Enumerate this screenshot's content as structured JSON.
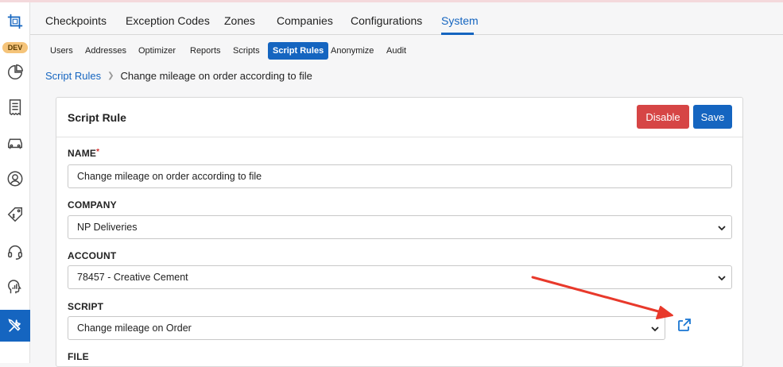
{
  "sidebar": {
    "badge": "DEV",
    "icons": [
      "crop-logo-icon",
      "pie-chart-icon",
      "receipt-icon",
      "car-icon",
      "user-circle-icon",
      "price-tag-icon",
      "headset-icon",
      "analytics-head-icon",
      "tools-icon"
    ],
    "active_item": "tools-icon"
  },
  "nav": {
    "tabs": [
      "Checkpoints",
      "Exception Codes",
      "Zones",
      "Companies",
      "Configurations",
      "System"
    ],
    "active_tab": "System"
  },
  "subnav": {
    "tabs": [
      "Users",
      "Addresses",
      "Optimizer",
      "Reports",
      "Scripts",
      "Script Rules",
      "Anonymize",
      "Audit"
    ],
    "active_tab": "Script Rules"
  },
  "breadcrumb": {
    "parent": "Script Rules",
    "current": "Change mileage on order according to file"
  },
  "card": {
    "title": "Script Rule",
    "disable_label": "Disable",
    "save_label": "Save"
  },
  "form": {
    "name_label": "NAME",
    "required_mark": "*",
    "name_value": "Change mileage on order according to file",
    "company_label": "COMPANY",
    "company_value": "NP Deliveries",
    "account_label": "ACCOUNT",
    "account_value": "78457 - Creative Cement",
    "script_label": "SCRIPT",
    "script_value": "Change mileage on Order",
    "file_label": "FILE"
  },
  "colors": {
    "accent": "#1565c0",
    "danger": "#d64545",
    "annotation_arrow": "#e8392b"
  }
}
